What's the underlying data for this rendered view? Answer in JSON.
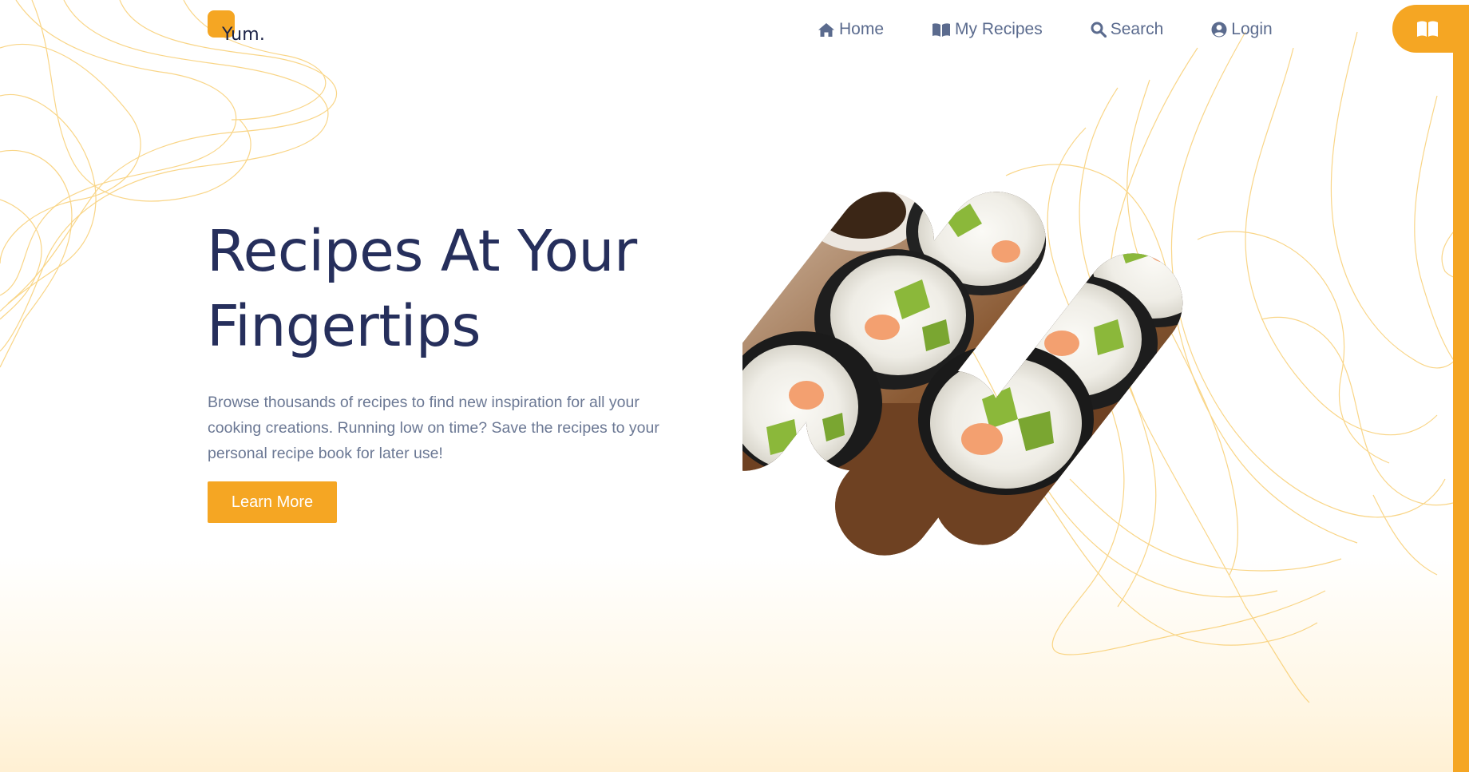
{
  "brand": {
    "name": "Yum.",
    "accent": "#f5a623",
    "title_color": "#262f5c",
    "body_color": "#6b7894"
  },
  "nav": {
    "items": [
      {
        "label": "Home",
        "icon": "home-icon"
      },
      {
        "label": "My Recipes",
        "icon": "book-icon"
      },
      {
        "label": "Search",
        "icon": "search-icon"
      },
      {
        "label": "Login",
        "icon": "user-circle-icon"
      }
    ]
  },
  "side_tab": {
    "icon": "book-open-icon"
  },
  "hero": {
    "title_line1": "Recipes At Your",
    "title_line2": "Fingertips",
    "description": "Browse thousands of recipes to find new inspiration for all your cooking creations. Running low on time? Save the recipes to your personal recipe book for later use!",
    "button_label": "Learn More",
    "image_subject": "sushi rolls"
  }
}
